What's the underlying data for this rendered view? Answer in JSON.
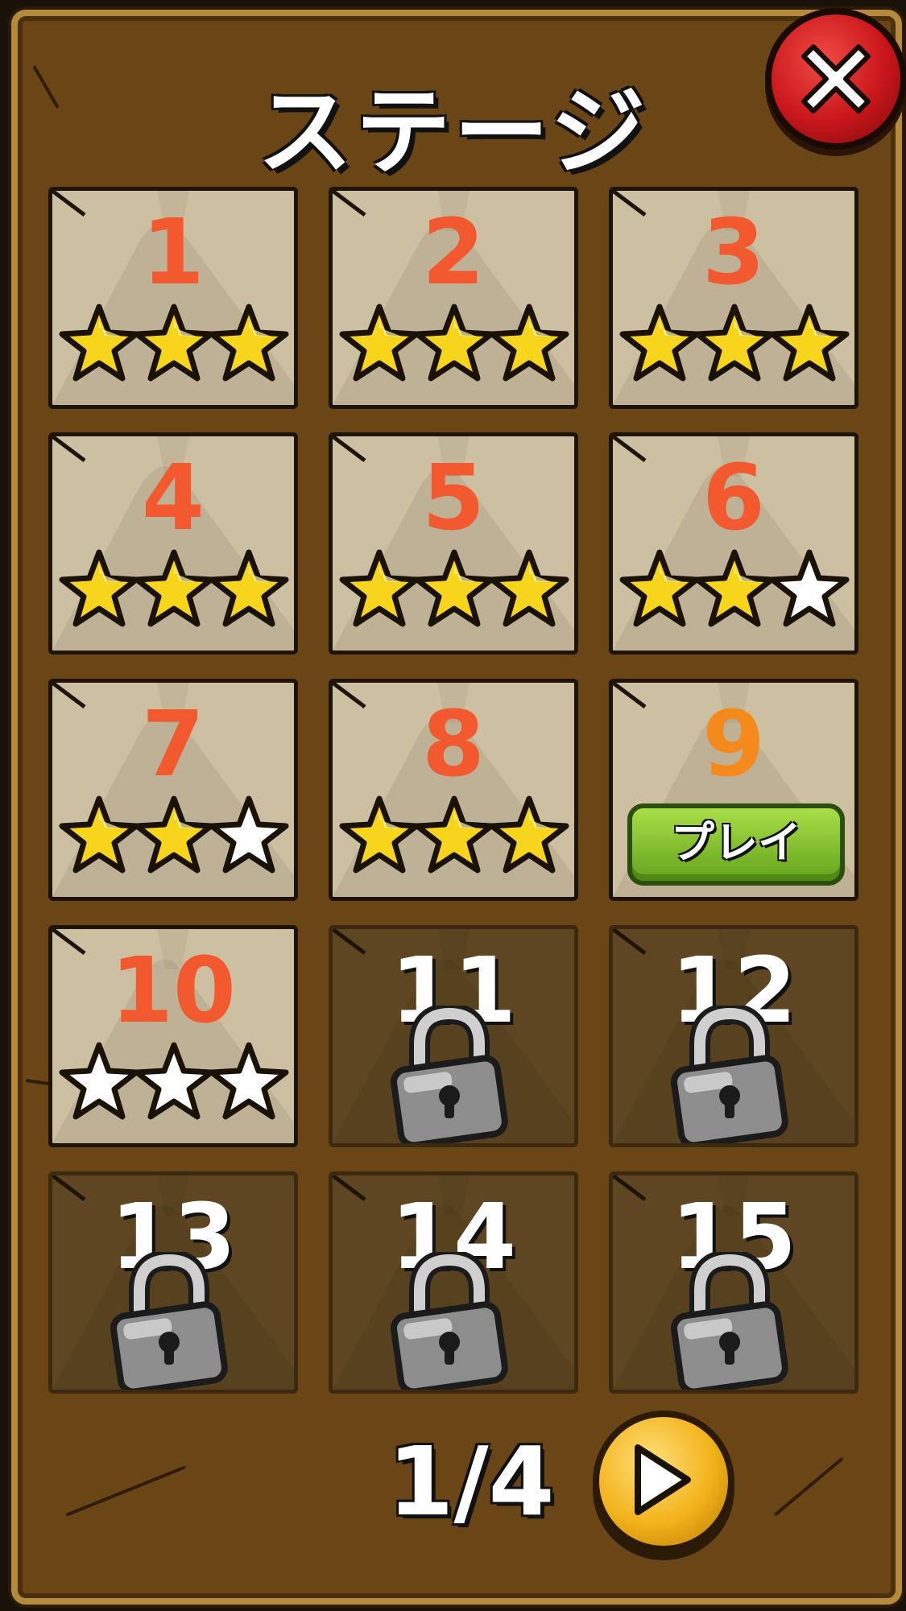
{
  "screen": {
    "title": "ステージ",
    "close_icon": "close-x-icon"
  },
  "stages": [
    {
      "number": "1",
      "stars": 3,
      "locked": false
    },
    {
      "number": "2",
      "stars": 3,
      "locked": false
    },
    {
      "number": "3",
      "stars": 3,
      "locked": false
    },
    {
      "number": "4",
      "stars": 3,
      "locked": false
    },
    {
      "number": "5",
      "stars": 3,
      "locked": false
    },
    {
      "number": "6",
      "stars": 2,
      "locked": false
    },
    {
      "number": "7",
      "stars": 2,
      "locked": false
    },
    {
      "number": "8",
      "stars": 3,
      "locked": false
    },
    {
      "number": "9",
      "stars": 0,
      "locked": false,
      "current": true,
      "play_label": "プレイ"
    },
    {
      "number": "10",
      "stars": 0,
      "locked": false
    },
    {
      "number": "11",
      "stars": 0,
      "locked": true
    },
    {
      "number": "12",
      "stars": 0,
      "locked": true
    },
    {
      "number": "13",
      "stars": 0,
      "locked": true
    },
    {
      "number": "14",
      "stars": 0,
      "locked": true
    },
    {
      "number": "15",
      "stars": 0,
      "locked": true
    }
  ],
  "pager": {
    "label": "1/4",
    "next_icon": "play-arrow-icon"
  },
  "colors": {
    "board": "#6a4516",
    "tile": "#cdbfa1",
    "tile_locked": "#5e4622",
    "stage_number": "#f2592e",
    "star_filled": "#f7d51d",
    "star_empty": "#ffffff",
    "play_button": "#8cc832",
    "close_button": "#c8161a",
    "next_button": "#f2b21a"
  }
}
